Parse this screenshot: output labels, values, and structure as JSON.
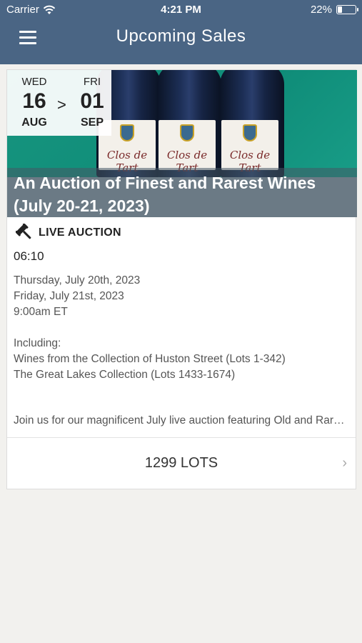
{
  "status_bar": {
    "carrier": "Carrier",
    "time": "4:21 PM",
    "battery": "22%",
    "battery_level": 0.22
  },
  "nav": {
    "title": "Upcoming Sales",
    "menu_icon": "hamburger-icon"
  },
  "sale": {
    "start": {
      "dow": "WED",
      "day": "16",
      "month": "AUG"
    },
    "separator": ">",
    "end": {
      "dow": "FRI",
      "day": "01",
      "month": "SEP"
    },
    "bottle_label": "Clos de Tart",
    "title": "An Auction of Finest and Rarest Wines (July 20-21, 2023)",
    "type": "LIVE AUCTION",
    "type_icon": "gavel-icon",
    "countdown": "06:10",
    "dates": [
      "Thursday, July 20th, 2023",
      "Friday, July 21st, 2023",
      "9:00am ET"
    ],
    "including_label": "Including:",
    "collections": [
      "Wines from the Collection of Huston Street (Lots 1-342)",
      "The Great Lakes Collection (Lots 1433-1674)"
    ],
    "summary": "Join us for our magnificent July live auction featuring Old and Rare wines",
    "lots": "1299 LOTS"
  },
  "colors": {
    "nav_bg": "#4a6584",
    "page_bg": "#f2f1ee",
    "hero_bg": "#17957f"
  }
}
